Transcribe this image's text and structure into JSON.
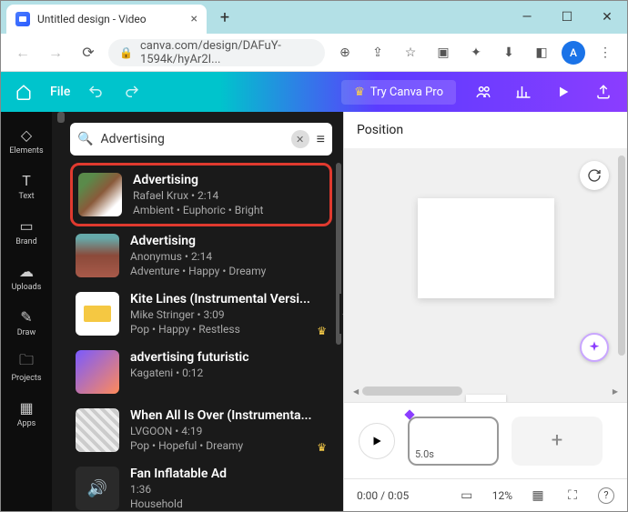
{
  "window": {
    "tab_title": "Untitled design - Video",
    "url": "canva.com/design/DAFuY-1594k/hyAr2I...",
    "avatar_letter": "A"
  },
  "appbar": {
    "file_label": "File",
    "try_pro_label": "Try Canva Pro"
  },
  "rail": [
    {
      "label": "Elements",
      "icon": "shapes"
    },
    {
      "label": "Text",
      "icon": "T"
    },
    {
      "label": "Brand",
      "icon": "brand"
    },
    {
      "label": "Uploads",
      "icon": "cloud"
    },
    {
      "label": "Draw",
      "icon": "pencil"
    },
    {
      "label": "Projects",
      "icon": "folder"
    },
    {
      "label": "Apps",
      "icon": "grid"
    }
  ],
  "search": {
    "value": "Advertising",
    "placeholder": "Search"
  },
  "results": [
    {
      "title": "Advertising",
      "sub": "Rafael Krux • 2:14",
      "tags": "Ambient • Euphoric • Bright",
      "highlighted": true,
      "pro": false
    },
    {
      "title": "Advertising",
      "sub": "Anonymus • 2:14",
      "tags": "Adventure • Happy • Dreamy",
      "highlighted": false,
      "pro": false
    },
    {
      "title": "Kite Lines (Instrumental Versi...",
      "sub": "Mike Stringer • 3:09",
      "tags": "Pop • Happy • Restless",
      "highlighted": false,
      "pro": true
    },
    {
      "title": "advertising futuristic",
      "sub": "Kagateni • 0:12",
      "tags": "",
      "highlighted": false,
      "pro": false
    },
    {
      "title": "When All Is Over (Instrumenta...",
      "sub": "LVGOON • 4:19",
      "tags": "Pop • Hopeful • Dreamy",
      "highlighted": false,
      "pro": true
    },
    {
      "title": "Fan Inflatable Ad",
      "sub": "1:36",
      "tags": "Household",
      "highlighted": false,
      "pro": false
    }
  ],
  "canvas": {
    "position_label": "Position",
    "clip_duration": "5.0s"
  },
  "footer": {
    "time": "0:00 / 0:05",
    "zoom": "12%"
  }
}
